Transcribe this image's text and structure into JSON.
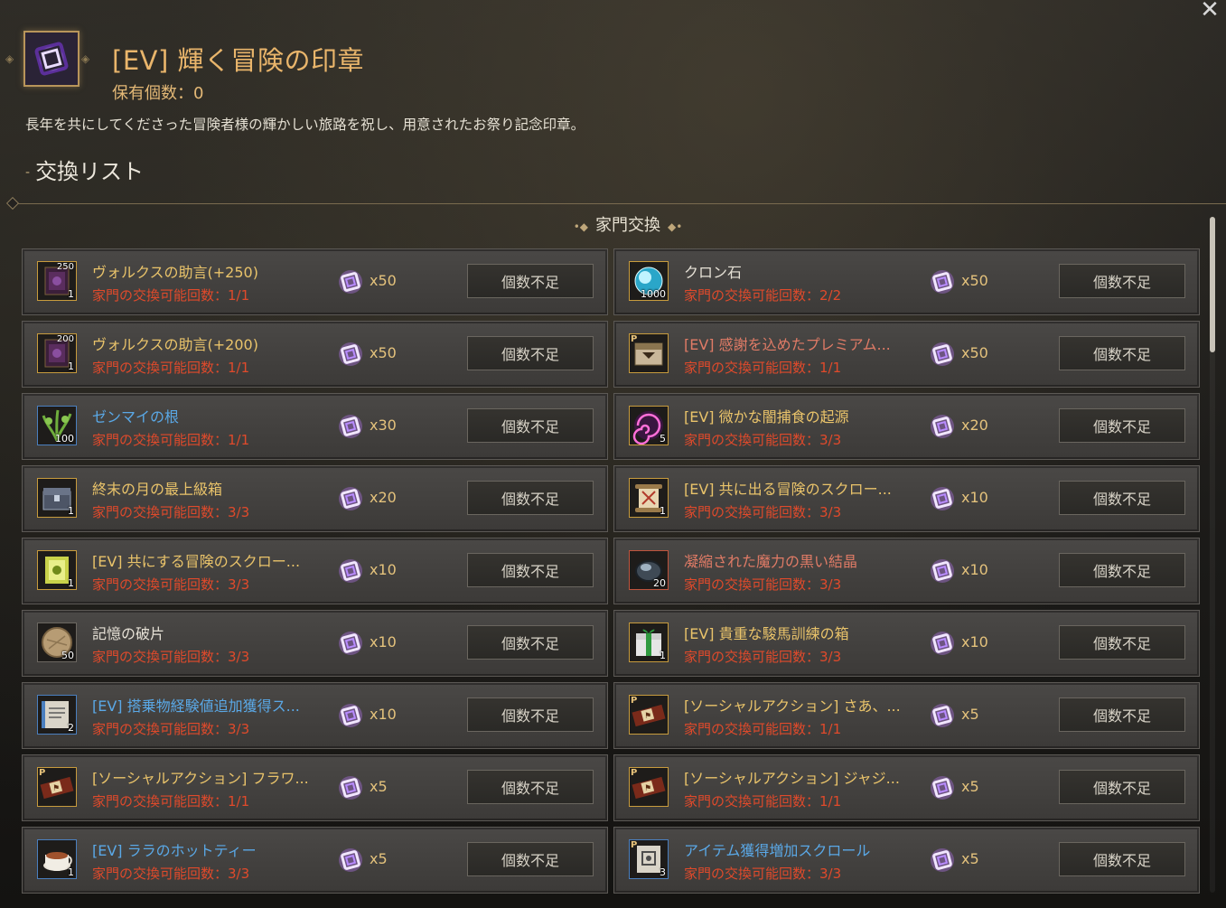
{
  "close_label": "✕",
  "header": {
    "title": "[EV] 輝く冒険の印章",
    "held": "保有個数：0",
    "description": "長年を共にしてくださった冒険者様の輝かしい旅路を祝し、用意されたお祭り記念印章。"
  },
  "section_title": "交換リスト",
  "subheader": "家門交換",
  "items": [
    {
      "name": "ヴォルクスの助言(+250)",
      "limit": "家門の交換可能回数：1/1",
      "cost": "x50",
      "button": "個数不足",
      "qty": "1",
      "topqty": "250",
      "name_color": "yellow",
      "frame": "gold",
      "icon": "volks-advice-icon"
    },
    {
      "name": "クロン石",
      "limit": "家門の交換可能回数：2/2",
      "cost": "x50",
      "button": "個数不足",
      "qty": "1000",
      "topqty": "",
      "name_color": "white",
      "frame": "gold",
      "icon": "cron-stone-icon"
    },
    {
      "name": "ヴォルクスの助言(+200)",
      "limit": "家門の交換可能回数：1/1",
      "cost": "x50",
      "button": "個数不足",
      "qty": "1",
      "topqty": "200",
      "name_color": "yellow",
      "frame": "gold",
      "icon": "volks-advice-icon"
    },
    {
      "name": "[EV] 感謝を込めたプレミアム...",
      "limit": "家門の交換可能回数：1/1",
      "cost": "x50",
      "button": "個数不足",
      "qty": "",
      "topqty": "",
      "name_color": "red",
      "frame": "gold",
      "icon": "premium-box-icon"
    },
    {
      "name": "ゼンマイの根",
      "limit": "家門の交換可能回数：1/1",
      "cost": "x30",
      "button": "個数不足",
      "qty": "100",
      "topqty": "",
      "name_color": "blue",
      "frame": "blue",
      "icon": "fern-root-icon"
    },
    {
      "name": "[EV] 微かな闇捕食の起源",
      "limit": "家門の交換可能回数：3/3",
      "cost": "x20",
      "button": "個数不足",
      "qty": "5",
      "topqty": "",
      "name_color": "yellow",
      "frame": "gold",
      "icon": "dark-origin-icon"
    },
    {
      "name": "終末の月の最上級箱",
      "limit": "家門の交換可能回数：3/3",
      "cost": "x20",
      "button": "個数不足",
      "qty": "1",
      "topqty": "",
      "name_color": "yellow",
      "frame": "gold",
      "icon": "chest-icon"
    },
    {
      "name": "[EV] 共に出る冒険のスクロー...",
      "limit": "家門の交換可能回数：3/3",
      "cost": "x10",
      "button": "個数不足",
      "qty": "1",
      "topqty": "",
      "name_color": "yellow",
      "frame": "gold",
      "icon": "scroll-icon"
    },
    {
      "name": "[EV] 共にする冒険のスクロー...",
      "limit": "家門の交換可能回数：3/3",
      "cost": "x10",
      "button": "個数不足",
      "qty": "1",
      "topqty": "",
      "name_color": "yellow",
      "frame": "gold",
      "icon": "scroll-green-icon"
    },
    {
      "name": "凝縮された魔力の黒い結晶",
      "limit": "家門の交換可能回数：3/3",
      "cost": "x10",
      "button": "個数不足",
      "qty": "20",
      "topqty": "",
      "name_color": "red",
      "frame": "red",
      "icon": "black-crystal-icon"
    },
    {
      "name": "記憶の破片",
      "limit": "家門の交換可能回数：3/3",
      "cost": "x10",
      "button": "個数不足",
      "qty": "50",
      "topqty": "",
      "name_color": "white",
      "frame": "plain",
      "icon": "memory-fragment-icon"
    },
    {
      "name": "[EV] 貴重な駿馬訓練の箱",
      "limit": "家門の交換可能回数：3/3",
      "cost": "x10",
      "button": "個数不足",
      "qty": "1",
      "topqty": "",
      "name_color": "yellow",
      "frame": "gold",
      "icon": "gift-box-icon"
    },
    {
      "name": "[EV] 搭乗物経験値追加獲得ス...",
      "limit": "家門の交換可能回数：3/3",
      "cost": "x10",
      "button": "個数不足",
      "qty": "2",
      "topqty": "",
      "name_color": "blue",
      "frame": "blue",
      "icon": "mount-scroll-icon"
    },
    {
      "name": "[ソーシャルアクション] さあ、...",
      "limit": "家門の交換可能回数：1/1",
      "cost": "x5",
      "button": "個数不足",
      "qty": "",
      "topqty": "",
      "name_color": "yellow",
      "frame": "gold",
      "icon": "social-action-icon"
    },
    {
      "name": "[ソーシャルアクション] フラワ...",
      "limit": "家門の交換可能回数：1/1",
      "cost": "x5",
      "button": "個数不足",
      "qty": "",
      "topqty": "",
      "name_color": "yellow",
      "frame": "gold",
      "icon": "social-action-icon"
    },
    {
      "name": "[ソーシャルアクション] ジャジ...",
      "limit": "家門の交換可能回数：1/1",
      "cost": "x5",
      "button": "個数不足",
      "qty": "",
      "topqty": "",
      "name_color": "yellow",
      "frame": "gold",
      "icon": "social-action-icon"
    },
    {
      "name": "[EV] ララのホットティー",
      "limit": "家門の交換可能回数：3/3",
      "cost": "x5",
      "button": "個数不足",
      "qty": "1",
      "topqty": "",
      "name_color": "blue",
      "frame": "blue",
      "icon": "hot-tea-icon"
    },
    {
      "name": "アイテム獲得増加スクロール",
      "limit": "家門の交換可能回数：3/3",
      "cost": "x5",
      "button": "個数不足",
      "qty": "3",
      "topqty": "",
      "name_color": "blue",
      "frame": "blue",
      "icon": "drop-scroll-icon"
    }
  ]
}
